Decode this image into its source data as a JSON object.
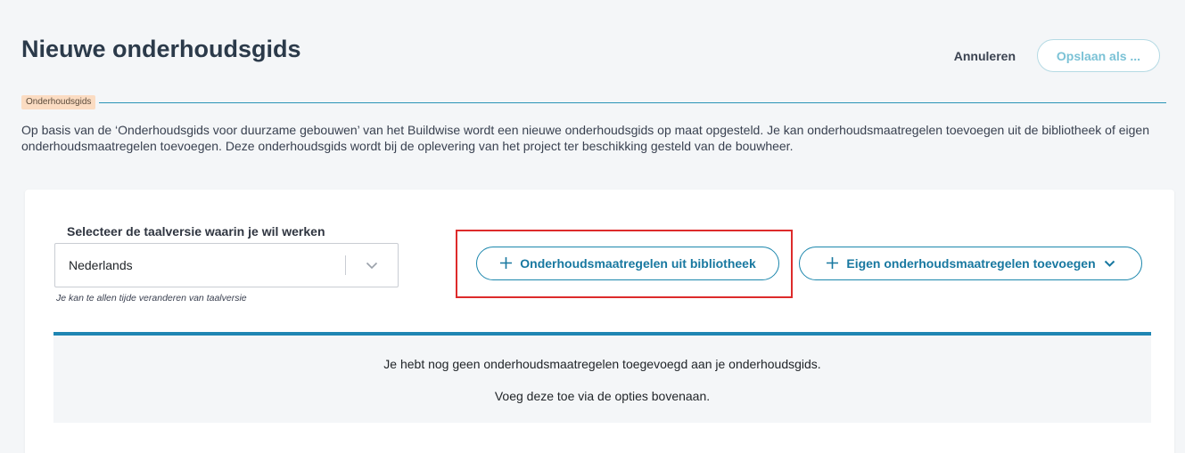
{
  "header": {
    "title": "Nieuwe onderhoudsgids",
    "cancel_label": "Annuleren",
    "save_label": "Opslaan als ..."
  },
  "section": {
    "tag": "Onderhoudsgids",
    "description": "Op basis van de ‘Onderhoudsgids voor duurzame gebouwen’ van het Buildwise wordt een nieuwe onderhoudsgids op maat opgesteld. Je kan onderhoudsmaatregelen toevoegen uit de bibliotheek of eigen onderhoudsmaatregelen toevoegen. Deze onderhoudsgids wordt bij de oplevering van het project ter beschikking gesteld van de bouwheer."
  },
  "language": {
    "label": "Selecteer de taalversie waarin je wil werken",
    "selected": "Nederlands",
    "hint": "Je kan te allen tijde veranderen van taalversie"
  },
  "actions": {
    "library_label": "Onderhoudsmaatregelen uit bibliotheek",
    "own_label": "Eigen onderhoudsmaatregelen toevoegen"
  },
  "empty_state": {
    "line1": "Je hebt nog geen onderhoudsmaatregelen toegevoegd aan je onderhoudsgids.",
    "line2": "Voeg deze toe via de opties bovenaan."
  },
  "colors": {
    "accent": "#1c87ad",
    "highlight": "#dd2b2b",
    "tag_bg": "#fbdcc2"
  },
  "icons": {
    "plus": "plus-icon",
    "chevron": "chevron-down-icon"
  }
}
